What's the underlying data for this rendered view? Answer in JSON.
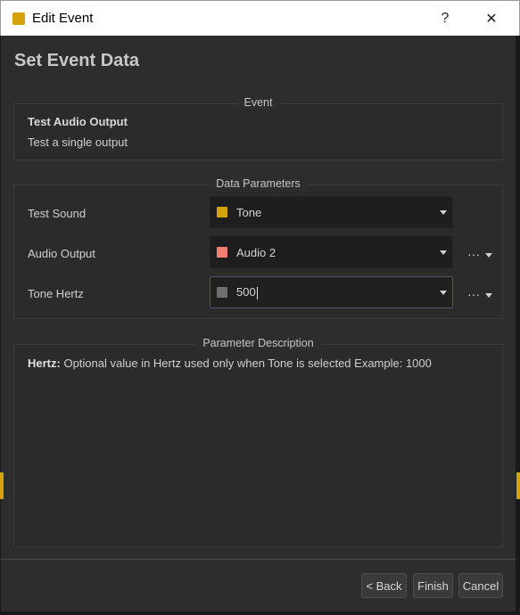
{
  "window": {
    "title": "Edit Event",
    "help_label": "?",
    "close_label": "✕",
    "accent_color": "#d4a20a"
  },
  "page": {
    "heading": "Set Event Data"
  },
  "event_group": {
    "title": "Event",
    "name": "Test Audio Output",
    "description": "Test a single output"
  },
  "params_group": {
    "title": "Data Parameters",
    "params": [
      {
        "label": "Test Sound",
        "value": "Tone",
        "color": "#d4a20a",
        "has_more": false
      },
      {
        "label": "Audio Output",
        "value": "Audio 2",
        "color": "#f08070",
        "has_more": true,
        "more_label": "···"
      },
      {
        "label": "Tone Hertz",
        "value": "500",
        "color": "#6e6e6e",
        "has_more": true,
        "more_label": "···",
        "focused": true
      }
    ]
  },
  "desc_group": {
    "title": "Parameter Description",
    "param_name": "Hertz:",
    "text": "Optional value in Hertz used only when Tone is selected Example: 1000"
  },
  "buttons": {
    "back": "< Back",
    "finish": "Finish",
    "cancel": "Cancel"
  }
}
